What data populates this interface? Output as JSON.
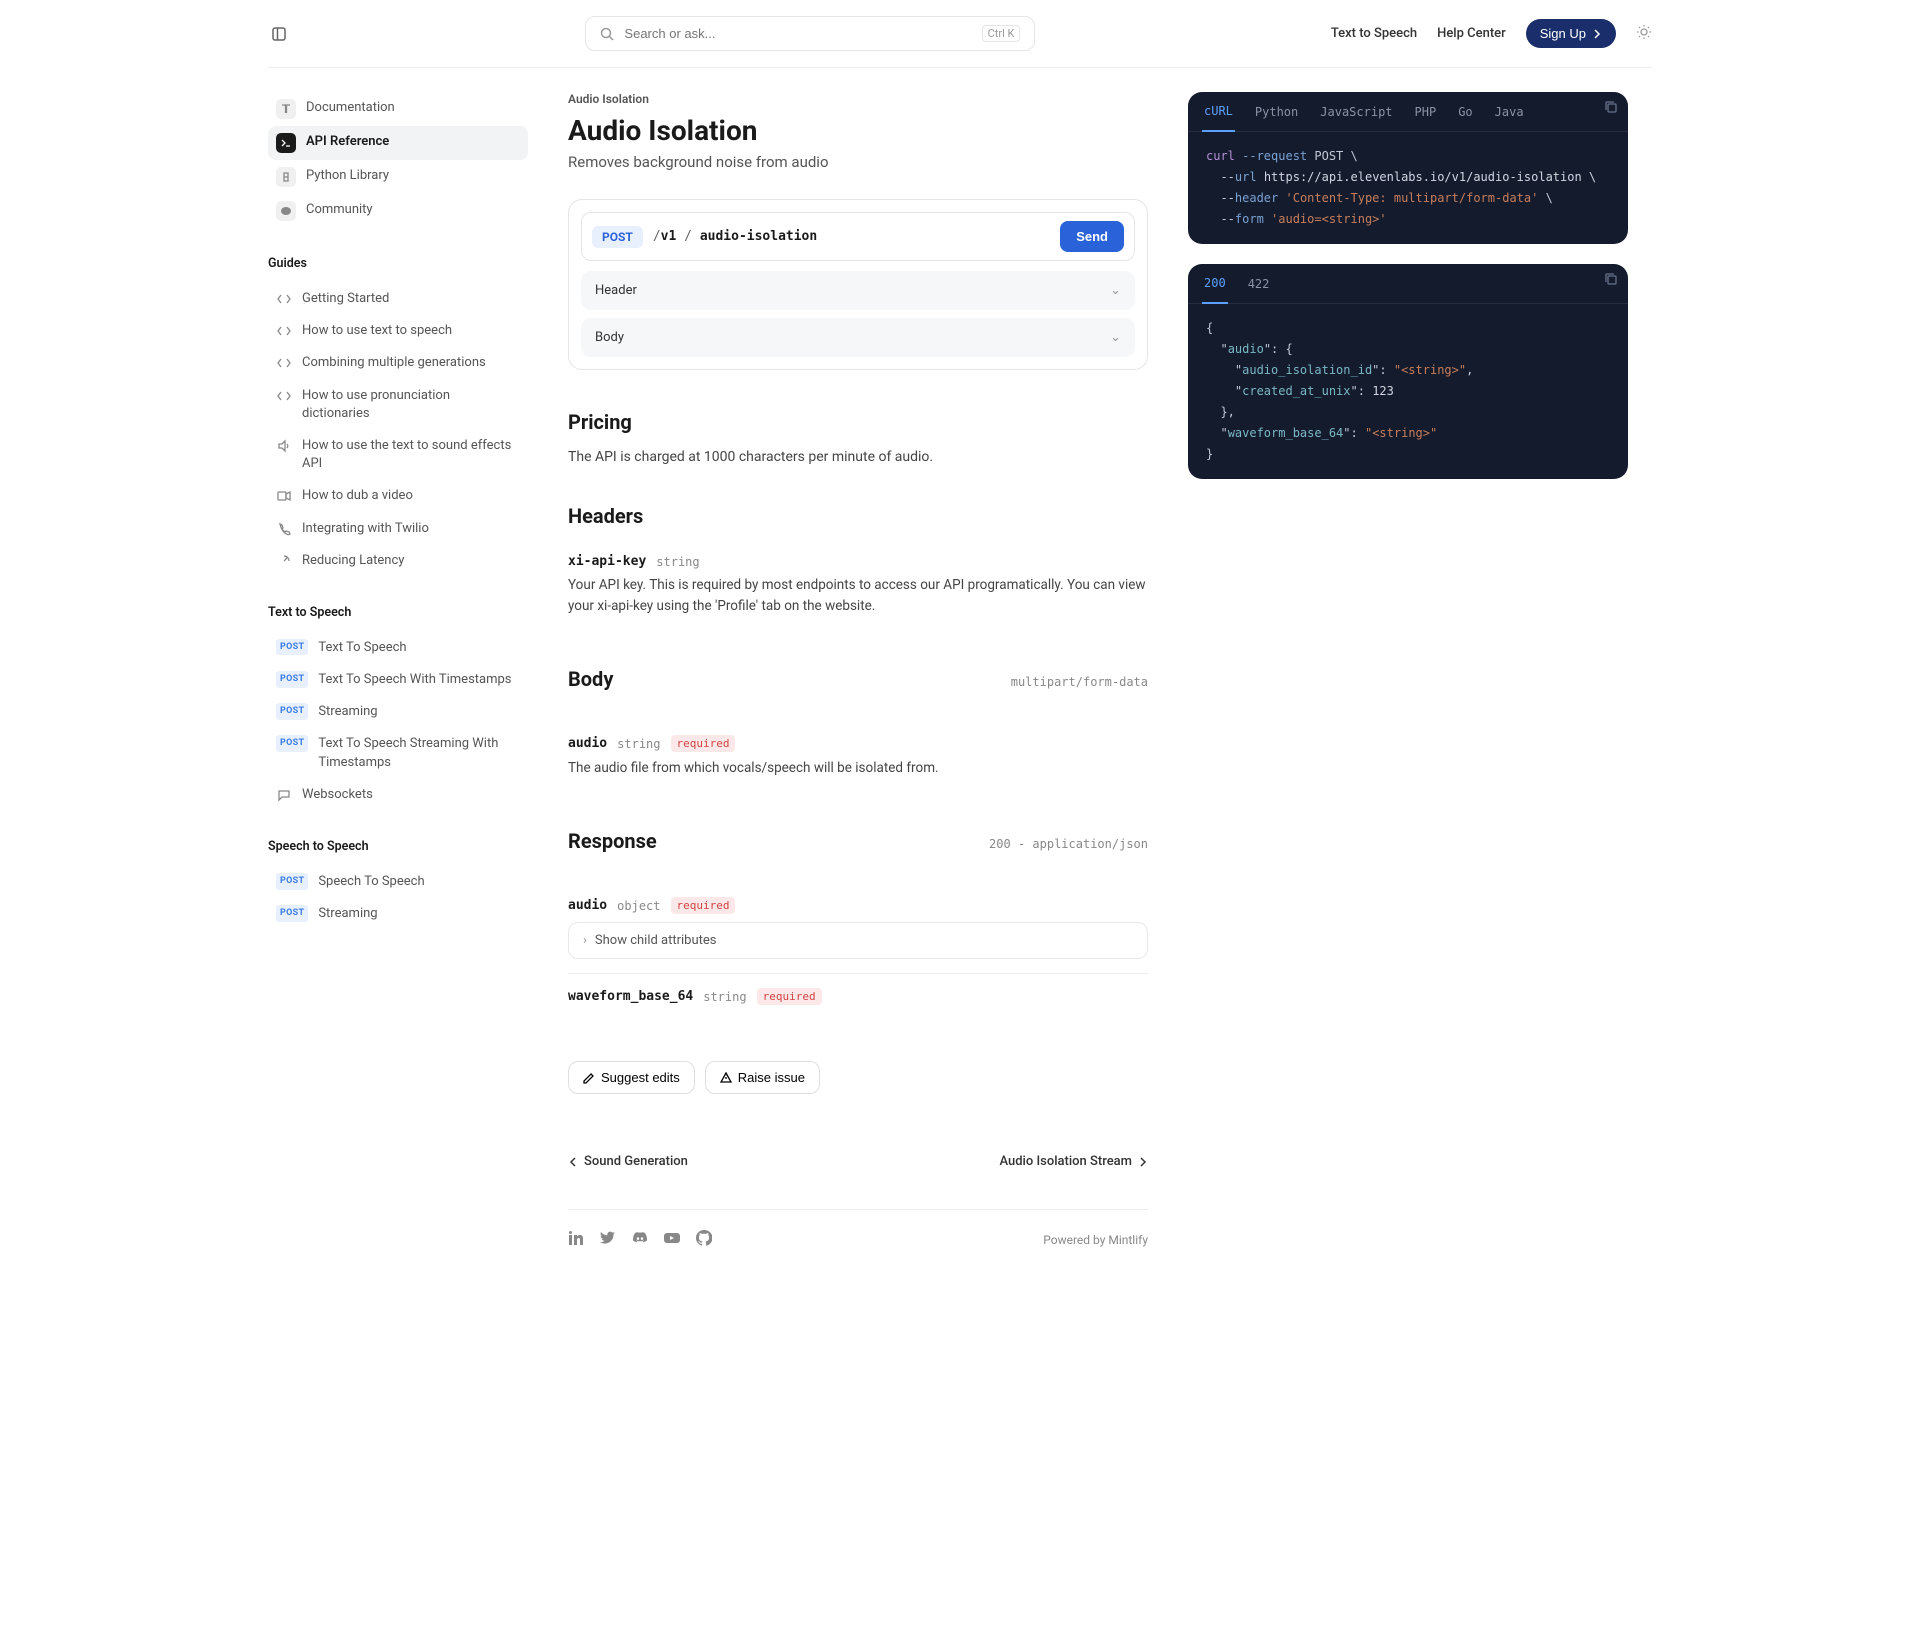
{
  "header": {
    "search_placeholder": "Search or ask...",
    "search_kbd": "Ctrl K",
    "links": {
      "tts": "Text to Speech",
      "help": "Help Center"
    },
    "signup": "Sign Up"
  },
  "sidebar": {
    "top": [
      {
        "label": "Documentation"
      },
      {
        "label": "API Reference"
      },
      {
        "label": "Python Library"
      },
      {
        "label": "Community"
      }
    ],
    "groups": [
      {
        "title": "Guides",
        "items": [
          "Getting Started",
          "How to use text to speech",
          "Combining multiple generations",
          "How to use pronunciation dictionaries",
          "How to use the text to sound effects API",
          "How to dub a video",
          "Integrating with Twilio",
          "Reducing Latency"
        ]
      },
      {
        "title": "Text to Speech",
        "items": [
          "Text To Speech",
          "Text To Speech With Timestamps",
          "Streaming",
          "Text To Speech Streaming With Timestamps",
          "Websockets"
        ]
      },
      {
        "title": "Speech to Speech",
        "items": [
          "Speech To Speech",
          "Streaming"
        ]
      }
    ]
  },
  "main": {
    "breadcrumb": "Audio Isolation",
    "title": "Audio Isolation",
    "subtitle": "Removes background noise from audio",
    "endpoint": {
      "method": "POST",
      "path_prefix": "/",
      "path_v": "v1",
      "path_sep": " / ",
      "path_end": "audio-isolation",
      "send": "Send",
      "collapse1": "Header",
      "collapse2": "Body"
    },
    "pricing_title": "Pricing",
    "pricing_text": "The API is charged at 1000 characters per minute of audio.",
    "headers_title": "Headers",
    "header_param": {
      "name": "xi-api-key",
      "type": "string",
      "desc": "Your API key. This is required by most endpoints to access our API programatically. You can view your xi-api-key using the 'Profile' tab on the website."
    },
    "body_title": "Body",
    "body_meta": "multipart/form-data",
    "body_param": {
      "name": "audio",
      "type": "string",
      "required": "required",
      "desc": "The audio file from which vocals/speech will be isolated from."
    },
    "response_title": "Response",
    "response_meta": "200 - application/json",
    "resp_param1": {
      "name": "audio",
      "type": "object",
      "required": "required",
      "child": "Show child attributes"
    },
    "resp_param2": {
      "name": "waveform_base_64",
      "type": "string",
      "required": "required"
    },
    "suggest": "Suggest edits",
    "raise": "Raise issue",
    "prev": "Sound Generation",
    "next": "Audio Isolation Stream",
    "powered": "Powered by Mintlify"
  },
  "code": {
    "tabs": [
      "cURL",
      "Python",
      "JavaScript",
      "PHP",
      "Go",
      "Java"
    ],
    "req": {
      "l1a": "curl ",
      "l1b": "--request",
      "l1c": " POST \\",
      "l2a": "  --",
      "l2b": "url",
      "l2c": " https://api.elevenlabs.io/v1/audio-isolation \\",
      "l3a": "  --",
      "l3b": "header",
      "l3c": " 'Content-Type: multipart/form-data'",
      "l3d": " \\",
      "l4a": "  --",
      "l4b": "form",
      "l4c": " 'audio=<string>'"
    },
    "resp_tabs": [
      "200",
      "422"
    ],
    "resp": {
      "l1": "{",
      "l2a": "  \"",
      "l2b": "audio",
      "l2c": "\": {",
      "l3a": "    \"",
      "l3b": "audio_isolation_id",
      "l3c": "\": ",
      "l3d": "\"<string>\"",
      "l3e": ",",
      "l4a": "    \"",
      "l4b": "created_at_unix",
      "l4c": "\": ",
      "l4d": "123",
      "l5": "  },",
      "l6a": "  \"",
      "l6b": "waveform_base_64",
      "l6c": "\": ",
      "l6d": "\"<string>\"",
      "l7": "}"
    }
  }
}
